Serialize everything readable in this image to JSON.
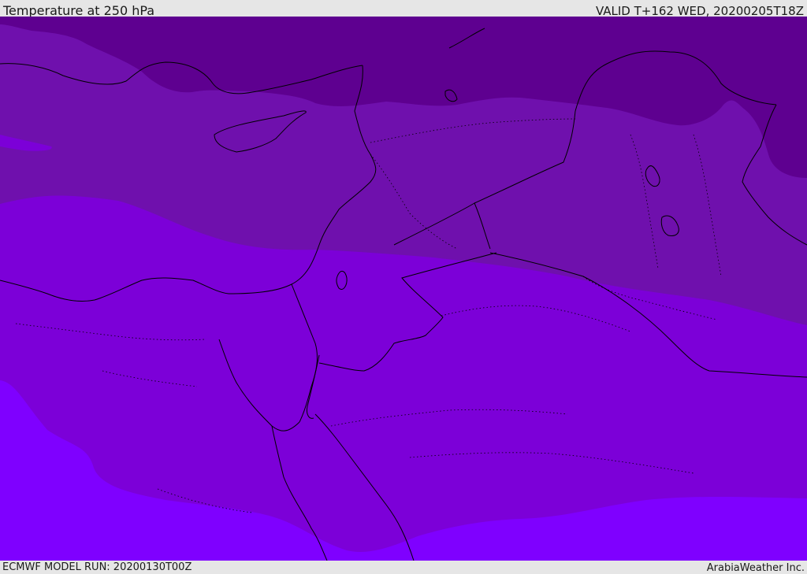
{
  "header": {
    "title": "Temperature at 250 hPa",
    "valid": "VALID T+162 WED, 20200205T18Z"
  },
  "footer": {
    "model_run": "ECMWF MODEL RUN: 20200130T00Z",
    "credit": "ArabiaWeather Inc."
  },
  "map": {
    "colors": {
      "coldest_band": "#5e0090",
      "cold_band": "#6f10ad",
      "mid_band": "#7c00d8",
      "warm_band": "#7f00ff",
      "borders": "#000000"
    }
  }
}
